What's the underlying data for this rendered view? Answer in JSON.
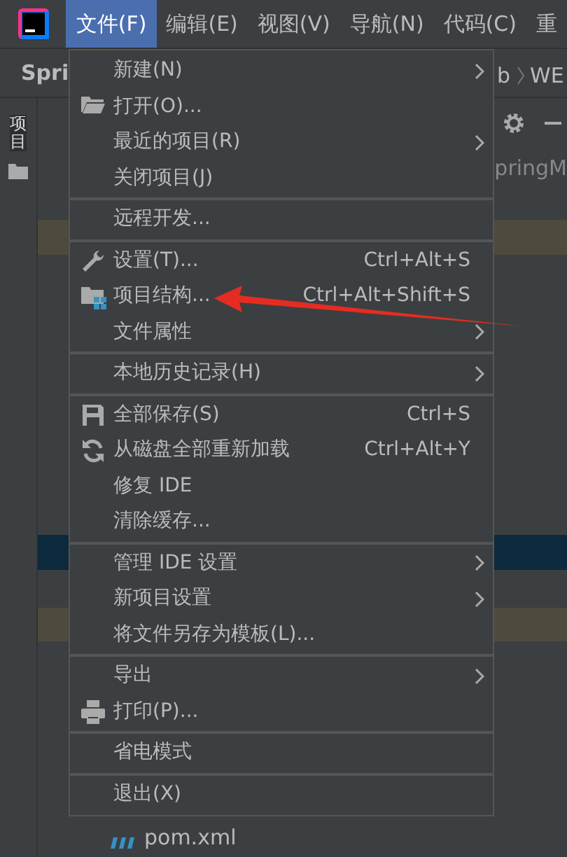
{
  "menubar": [
    {
      "label": "文件(F)",
      "selected": true
    },
    {
      "label": "编辑(E)",
      "selected": false
    },
    {
      "label": "视图(V)",
      "selected": false
    },
    {
      "label": "导航(N)",
      "selected": false
    },
    {
      "label": "代码(C)",
      "selected": false
    },
    {
      "label": "重",
      "selected": false
    }
  ],
  "navbar": {
    "project": "Spri",
    "breadcrumb": [
      "b",
      "WE"
    ]
  },
  "tool_window": {
    "stripe_label": "项目",
    "tree_text": "pringM",
    "file": "pom.xml"
  },
  "file_menu": {
    "items": [
      {
        "kind": "item",
        "label": "新建(N)",
        "submenu": true
      },
      {
        "kind": "item",
        "label": "打开(O)...",
        "submenu": false
      },
      {
        "kind": "item",
        "label": "最近的项目(R)",
        "submenu": true
      },
      {
        "kind": "item",
        "label": "关闭项目(J)",
        "submenu": false
      },
      {
        "kind": "separator"
      },
      {
        "kind": "item",
        "label": "远程开发...",
        "submenu": false
      },
      {
        "kind": "separator"
      },
      {
        "kind": "item",
        "label": "设置(T)...",
        "shortcut": "Ctrl+Alt+S",
        "submenu": false
      },
      {
        "kind": "item",
        "label": "项目结构...",
        "shortcut": "Ctrl+Alt+Shift+S",
        "submenu": false,
        "pointed_at": true
      },
      {
        "kind": "item",
        "label": "文件属性",
        "submenu": true
      },
      {
        "kind": "separator"
      },
      {
        "kind": "item",
        "label": "本地历史记录(H)",
        "submenu": true
      },
      {
        "kind": "separator"
      },
      {
        "kind": "item",
        "label": "全部保存(S)",
        "shortcut": "Ctrl+S",
        "submenu": false
      },
      {
        "kind": "item",
        "label": "从磁盘全部重新加载",
        "shortcut": "Ctrl+Alt+Y",
        "submenu": false
      },
      {
        "kind": "item",
        "label": "修复 IDE",
        "submenu": false
      },
      {
        "kind": "item",
        "label": "清除缓存...",
        "submenu": false
      },
      {
        "kind": "separator"
      },
      {
        "kind": "item",
        "label": "管理 IDE 设置",
        "submenu": true
      },
      {
        "kind": "item",
        "label": "新项目设置",
        "submenu": true
      },
      {
        "kind": "item",
        "label": "将文件另存为模板(L)...",
        "submenu": false
      },
      {
        "kind": "separator"
      },
      {
        "kind": "item",
        "label": "导出",
        "submenu": true
      },
      {
        "kind": "item",
        "label": "打印(P)...",
        "submenu": false
      },
      {
        "kind": "separator"
      },
      {
        "kind": "item",
        "label": "省电模式",
        "submenu": false
      },
      {
        "kind": "separator"
      },
      {
        "kind": "item",
        "label": "退出(X)",
        "submenu": false
      }
    ]
  }
}
